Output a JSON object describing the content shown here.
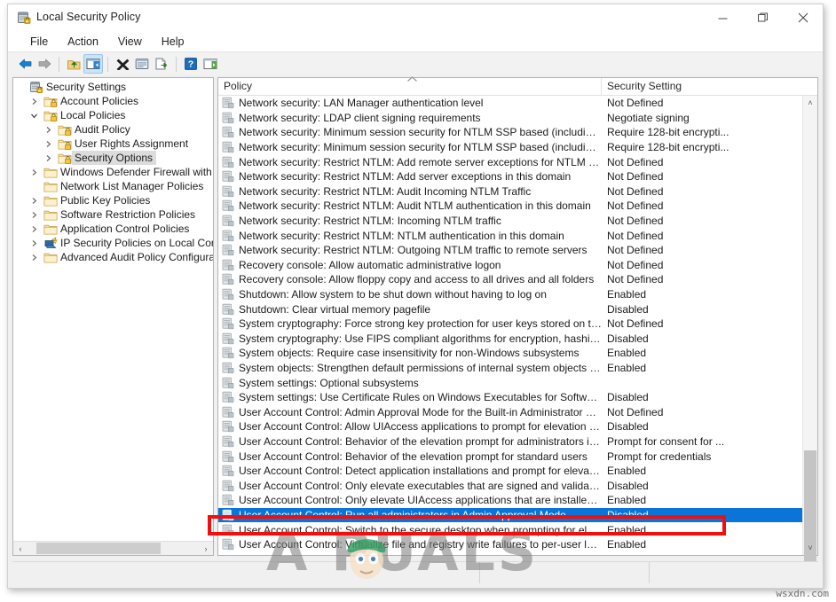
{
  "window": {
    "title": "Local Security Policy",
    "icon": "security-policy-icon",
    "controls": {
      "minimize": "—",
      "maximize": "❐",
      "close": "✕"
    }
  },
  "menubar": {
    "items": [
      {
        "label": "File",
        "name": "menu-file"
      },
      {
        "label": "Action",
        "name": "menu-action"
      },
      {
        "label": "View",
        "name": "menu-view"
      },
      {
        "label": "Help",
        "name": "menu-help"
      }
    ]
  },
  "toolbar": {
    "buttons": [
      {
        "name": "back-icon",
        "tip": "Back"
      },
      {
        "name": "forward-icon",
        "tip": "Forward"
      },
      {
        "name": "up-one-level-icon",
        "tip": "Up One Level"
      },
      {
        "name": "show-hide-console-tree-icon",
        "tip": "Show/Hide Console Tree",
        "selected": true
      },
      {
        "name": "delete-icon",
        "tip": "Delete"
      },
      {
        "name": "properties-icon",
        "tip": "Properties"
      },
      {
        "name": "export-list-icon",
        "tip": "Export List"
      },
      {
        "name": "help-icon",
        "tip": "Help"
      },
      {
        "name": "show-hide-action-pane-icon",
        "tip": "Show/Hide Action Pane"
      }
    ]
  },
  "tree": {
    "root": "Security Settings",
    "items": [
      {
        "label": "Security Settings",
        "depth": 0,
        "expander": "none",
        "icon": "security-settings-icon",
        "selected": false
      },
      {
        "label": "Account Policies",
        "depth": 1,
        "expander": "collapsed",
        "icon": "locked-folder-icon",
        "selected": false
      },
      {
        "label": "Local Policies",
        "depth": 1,
        "expander": "expanded",
        "icon": "locked-folder-icon",
        "selected": false
      },
      {
        "label": "Audit Policy",
        "depth": 2,
        "expander": "collapsed",
        "icon": "locked-folder-icon",
        "selected": false
      },
      {
        "label": "User Rights Assignment",
        "depth": 2,
        "expander": "collapsed",
        "icon": "locked-folder-icon",
        "selected": false
      },
      {
        "label": "Security Options",
        "depth": 2,
        "expander": "collapsed",
        "icon": "locked-folder-icon",
        "selected": true
      },
      {
        "label": "Windows Defender Firewall with Adva",
        "depth": 1,
        "expander": "collapsed",
        "icon": "folder-icon",
        "selected": false
      },
      {
        "label": "Network List Manager Policies",
        "depth": 1,
        "expander": "none",
        "icon": "folder-icon",
        "selected": false
      },
      {
        "label": "Public Key Policies",
        "depth": 1,
        "expander": "collapsed",
        "icon": "folder-icon",
        "selected": false
      },
      {
        "label": "Software Restriction Policies",
        "depth": 1,
        "expander": "collapsed",
        "icon": "folder-icon",
        "selected": false
      },
      {
        "label": "Application Control Policies",
        "depth": 1,
        "expander": "collapsed",
        "icon": "folder-icon",
        "selected": false
      },
      {
        "label": "IP Security Policies on Local Compute",
        "depth": 1,
        "expander": "collapsed",
        "icon": "ip-security-icon",
        "selected": false
      },
      {
        "label": "Advanced Audit Policy Configuration",
        "depth": 1,
        "expander": "collapsed",
        "icon": "folder-icon",
        "selected": false
      }
    ]
  },
  "list": {
    "columns": [
      {
        "label": "Policy",
        "name": "column-policy",
        "sort": "ascending"
      },
      {
        "label": "Security Setting",
        "name": "column-security-setting",
        "sort": "none"
      }
    ],
    "rows": [
      {
        "policy": "Network security: LAN Manager authentication level",
        "setting": "Not Defined",
        "selected": false
      },
      {
        "policy": "Network security: LDAP client signing requirements",
        "setting": "Negotiate signing",
        "selected": false
      },
      {
        "policy": "Network security: Minimum session security for NTLM SSP based (including secure R...",
        "setting": "Require 128-bit encrypti...",
        "selected": false
      },
      {
        "policy": "Network security: Minimum session security for NTLM SSP based (including secure R...",
        "setting": "Require 128-bit encrypti...",
        "selected": false
      },
      {
        "policy": "Network security: Restrict NTLM: Add remote server exceptions for NTLM authenticati...",
        "setting": "Not Defined",
        "selected": false
      },
      {
        "policy": "Network security: Restrict NTLM: Add server exceptions in this domain",
        "setting": "Not Defined",
        "selected": false
      },
      {
        "policy": "Network security: Restrict NTLM: Audit Incoming NTLM Traffic",
        "setting": "Not Defined",
        "selected": false
      },
      {
        "policy": "Network security: Restrict NTLM: Audit NTLM authentication in this domain",
        "setting": "Not Defined",
        "selected": false
      },
      {
        "policy": "Network security: Restrict NTLM: Incoming NTLM traffic",
        "setting": "Not Defined",
        "selected": false
      },
      {
        "policy": "Network security: Restrict NTLM: NTLM authentication in this domain",
        "setting": "Not Defined",
        "selected": false
      },
      {
        "policy": "Network security: Restrict NTLM: Outgoing NTLM traffic to remote servers",
        "setting": "Not Defined",
        "selected": false
      },
      {
        "policy": "Recovery console: Allow automatic administrative logon",
        "setting": "Not Defined",
        "selected": false
      },
      {
        "policy": "Recovery console: Allow floppy copy and access to all drives and all folders",
        "setting": "Not Defined",
        "selected": false
      },
      {
        "policy": "Shutdown: Allow system to be shut down without having to log on",
        "setting": "Enabled",
        "selected": false
      },
      {
        "policy": "Shutdown: Clear virtual memory pagefile",
        "setting": "Disabled",
        "selected": false
      },
      {
        "policy": "System cryptography: Force strong key protection for user keys stored on the computer",
        "setting": "Not Defined",
        "selected": false
      },
      {
        "policy": "System cryptography: Use FIPS compliant algorithms for encryption, hashing, and sig...",
        "setting": "Disabled",
        "selected": false
      },
      {
        "policy": "System objects: Require case insensitivity for non-Windows subsystems",
        "setting": "Enabled",
        "selected": false
      },
      {
        "policy": "System objects: Strengthen default permissions of internal system objects (e.g. Symb...",
        "setting": "Enabled",
        "selected": false
      },
      {
        "policy": "System settings: Optional subsystems",
        "setting": "",
        "selected": false
      },
      {
        "policy": "System settings: Use Certificate Rules on Windows Executables for Software Restrictio...",
        "setting": "Disabled",
        "selected": false
      },
      {
        "policy": "User Account Control: Admin Approval Mode for the Built-in Administrator account",
        "setting": "Not Defined",
        "selected": false
      },
      {
        "policy": "User Account Control: Allow UIAccess applications to prompt for elevation without u...",
        "setting": "Disabled",
        "selected": false
      },
      {
        "policy": "User Account Control: Behavior of the elevation prompt for administrators in Admin ...",
        "setting": "Prompt for consent for ...",
        "selected": false
      },
      {
        "policy": "User Account Control: Behavior of the elevation prompt for standard users",
        "setting": "Prompt for credentials",
        "selected": false
      },
      {
        "policy": "User Account Control: Detect application installations and prompt for elevation",
        "setting": "Enabled",
        "selected": false
      },
      {
        "policy": "User Account Control: Only elevate executables that are signed and validated",
        "setting": "Disabled",
        "selected": false
      },
      {
        "policy": "User Account Control: Only elevate UIAccess applications that are installed in secure l",
        "setting": "Enabled",
        "selected": false
      },
      {
        "policy": "User Account Control: Run all administrators in Admin Approval Mode",
        "setting": "Disabled",
        "selected": true
      },
      {
        "policy": "User Account Control: Switch to the secure desktop when prompting for elevation",
        "setting": "Enabled",
        "selected": false
      },
      {
        "policy": "User Account Control: Virtualize file and registry write failures to per-user locations",
        "setting": "Enabled",
        "selected": false
      }
    ]
  },
  "scrollbars": {
    "tree_horizontal": {
      "left_arrow": "‹",
      "right_arrow": "›"
    },
    "list_vertical": {
      "up_arrow": "˄",
      "down_arrow": "˅"
    }
  },
  "annotation": {
    "highlight_box_color": "#f40d0d",
    "highlight_row": "User Account Control: Run all administrators in Admin Approval Mode",
    "highlight_value": "Disabled"
  },
  "watermarks": {
    "primary": "A  PUALS",
    "secondary": "wsxdn.com"
  },
  "colors": {
    "selection_blue": "#0a74d8",
    "tree_selection_gray": "#dcdcdc",
    "toolbar_selected": "#cce4f7"
  }
}
